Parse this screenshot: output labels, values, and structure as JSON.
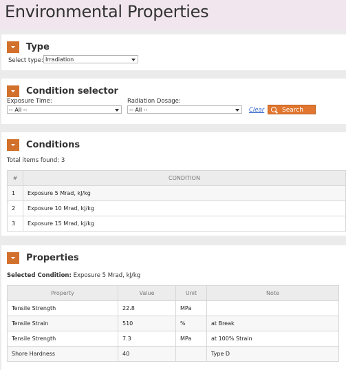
{
  "page": {
    "title": "Environmental Properties"
  },
  "type_panel": {
    "title": "Type",
    "select_label": "Select type:",
    "select_value": "Irradiation"
  },
  "condition_selector": {
    "title": "Condition selector",
    "exposure_label": "Exposure Time:",
    "exposure_value": "-- All --",
    "dosage_label": "Radiation Dosage:",
    "dosage_value": "-- All --",
    "clear_label": "Clear",
    "search_label": "Search"
  },
  "conditions": {
    "title": "Conditions",
    "total_label": "Total items found: 3",
    "headers": [
      "#",
      "CONDITION"
    ],
    "rows": [
      {
        "num": "1",
        "condition": "Exposure 5 Mrad, kJ/kg"
      },
      {
        "num": "2",
        "condition": "Exposure 10 Mrad, kJ/kg"
      },
      {
        "num": "3",
        "condition": "Exposure 15 Mrad, kJ/kg"
      }
    ]
  },
  "properties": {
    "title": "Properties",
    "selected_label": "Selected Condition:",
    "selected_value": "Exposure 5 Mrad, kJ/kg",
    "headers": [
      "Property",
      "Value",
      "Unit",
      "Note"
    ],
    "rows": [
      {
        "property": "Tensile Strength",
        "value": "22.8",
        "unit": "MPa",
        "note": ""
      },
      {
        "property": "Tensile Strain",
        "value": "510",
        "unit": "%",
        "note": "at Break"
      },
      {
        "property": "Tensile Strength",
        "value": "7.3",
        "unit": "MPa",
        "note": "at 100% Strain"
      },
      {
        "property": "Shore Hardness",
        "value": "40",
        "unit": "",
        "note": "Type D"
      }
    ]
  },
  "colors": {
    "accent": "#d2712c",
    "header_bg": "#f1e6ee",
    "link": "#3366cc"
  }
}
